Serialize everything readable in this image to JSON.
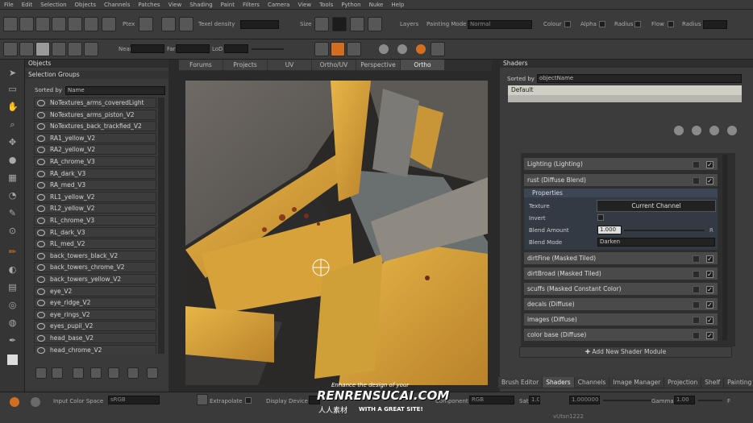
{
  "menu": [
    "File",
    "Edit",
    "Selection",
    "Objects",
    "Channels",
    "Patches",
    "View",
    "Shading",
    "Paint",
    "Filters",
    "Camera",
    "View",
    "Tools",
    "Python",
    "Nuke",
    "Help"
  ],
  "toolbar1": {
    "items_label": "Ptex",
    "texel_density": "Texel density",
    "size": "Size",
    "layers": "Layers",
    "painting_mode_label": "Painting Mode",
    "painting_mode_value": "Normal",
    "colour": "Colour",
    "alpha": "Alpha",
    "radius1": "Radius",
    "flow": "Flow",
    "radius2": "Radius"
  },
  "toolbar2": {
    "near": "Near",
    "far": "Far",
    "lod": "LoD"
  },
  "objects_panel": {
    "title": "Objects",
    "section": "Selection Groups",
    "sorted_by_label": "Sorted by",
    "sorted_by_value": "Name",
    "items": [
      "NoTextures_arms_coveredLight",
      "NoTextures_arms_piston_V2",
      "NoTextures_back_trackfied_V2",
      "RA1_yellow_V2",
      "RA2_yellow_V2",
      "RA_chrome_V3",
      "RA_dark_V3",
      "RA_med_V3",
      "RL1_yellow_V2",
      "RL2_yellow_V2",
      "RL_chrome_V3",
      "RL_dark_V3",
      "RL_med_V2",
      "back_towers_black_V2",
      "back_towers_chrome_V2",
      "back_towers_yellow_V2",
      "eye_V2",
      "eye_ridge_V2",
      "eye_rings_V2",
      "eyes_pupil_V2",
      "head_base_V2",
      "head_chrome_V2"
    ]
  },
  "viewport_tabs": [
    "Forums",
    "Projects",
    "UV",
    "Ortho/UV",
    "Perspective",
    "Ortho"
  ],
  "viewport_active_tab": "Ortho",
  "shaders_panel": {
    "title": "Shaders",
    "sorted_by_label": "Sorted by",
    "sorted_by_value": "objectName",
    "selected_shader": "Default",
    "modules": [
      "Lighting (Lighting)",
      "rust (Diffuse Blend)"
    ],
    "properties": {
      "header": "Properties",
      "texture_label": "Texture",
      "texture_value": "Current Channel",
      "invert_label": "Invert",
      "blend_amount_label": "Blend Amount",
      "blend_amount_value": "1.000",
      "blend_amount_r": "R",
      "blend_mode_label": "Blend Mode",
      "blend_mode_value": "Darken"
    },
    "modules_after": [
      "dirtFine (Masked Tiled)",
      "dirtBroad (Masked Tiled)",
      "scuffs (Masked Constant Color)",
      "decals (Diffuse)",
      "images (Diffuse)",
      "color base (Diffuse)"
    ],
    "add_module": "Add New Shader Module"
  },
  "bottom_tabs": [
    "Brush Editor",
    "Shaders",
    "Channels",
    "Image Manager",
    "Projection",
    "Shelf",
    "Painting"
  ],
  "bottom_active_tab": "Shaders",
  "statusbar": {
    "input_color_space": "Input Color Space",
    "input_color_space_value": "sRGB",
    "extrapolate": "Extrapolate",
    "display_device": "Display Device",
    "component": "Component",
    "component_value": "RGB",
    "sat": "Sat",
    "sat_value": "1.0",
    "gain_value": "1.000000",
    "gamma": "Gamma",
    "gamma_value": "1.00",
    "f_label": "F",
    "version": "vUtsn1222"
  },
  "watermark": {
    "top": "Enhance the design of your",
    "main": "RENRENSUCAI.COM",
    "cn": "人人素材",
    "sub": "WITH A GREAT SITE!"
  },
  "colors": {
    "accent": "#d36d1f",
    "panel": "#3c3c3c",
    "yellow_metal": "#d9a436"
  }
}
